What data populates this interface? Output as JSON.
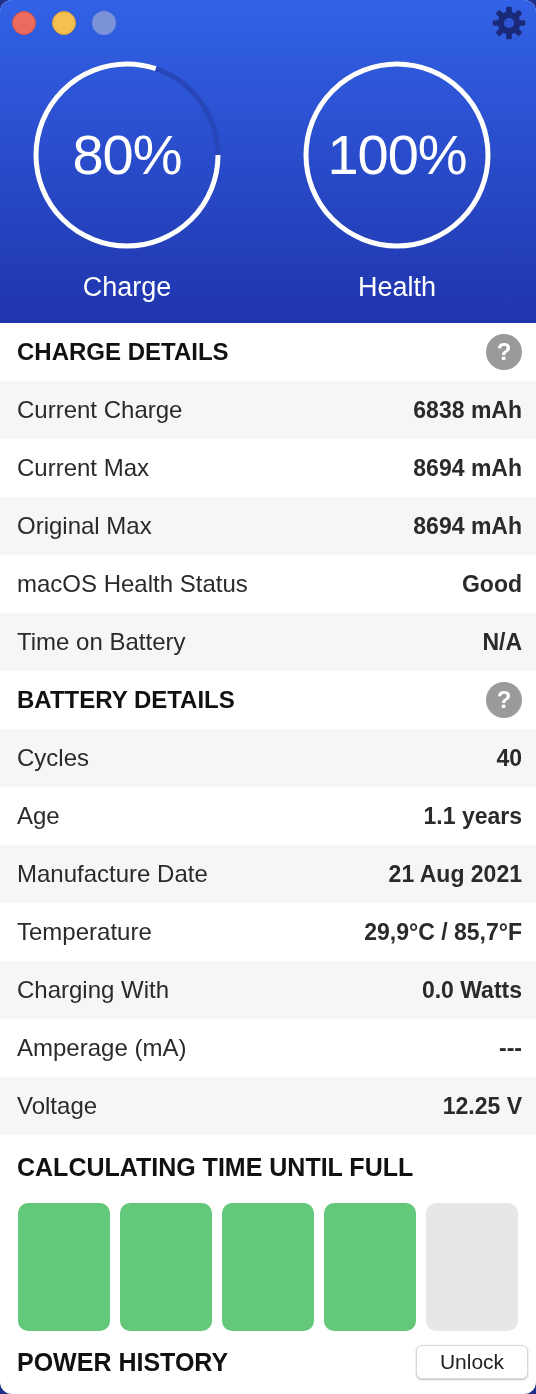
{
  "window": {
    "controls": [
      {
        "kind": "close"
      },
      {
        "kind": "minimize"
      },
      {
        "kind": "zoom"
      }
    ]
  },
  "gauges": [
    {
      "value": "80%",
      "label": "Charge",
      "kind": "partial"
    },
    {
      "value": "100%",
      "label": "Health",
      "kind": "full"
    }
  ],
  "sections": [
    {
      "title": "CHARGE DETAILS",
      "help": "?",
      "rows": [
        {
          "label": "Current Charge",
          "value": "6838 mAh"
        },
        {
          "label": "Current Max",
          "value": "8694 mAh"
        },
        {
          "label": "Original Max",
          "value": "8694 mAh"
        },
        {
          "label": "macOS Health Status",
          "value": "Good"
        },
        {
          "label": "Time on Battery",
          "value": "N/A"
        }
      ]
    },
    {
      "title": "BATTERY DETAILS",
      "help": "?",
      "rows": [
        {
          "label": "Cycles",
          "value": "40"
        },
        {
          "label": "Age",
          "value": "1.1 years"
        },
        {
          "label": "Manufacture Date",
          "value": "21 Aug 2021"
        },
        {
          "label": "Temperature",
          "value": "29,9°C / 85,7°F"
        },
        {
          "label": "Charging With",
          "value": "0.0 Watts"
        },
        {
          "label": "Amperage (mA)",
          "value": "---"
        },
        {
          "label": "Voltage",
          "value": "12.25 V"
        }
      ]
    }
  ],
  "time_until_full": {
    "title": "CALCULATING TIME UNTIL FULL",
    "blocks": [
      {
        "filled": true
      },
      {
        "filled": true
      },
      {
        "filled": true
      },
      {
        "filled": true
      },
      {
        "filled": false
      }
    ]
  },
  "power_history": {
    "title": "POWER HISTORY",
    "button": "Unlock"
  }
}
